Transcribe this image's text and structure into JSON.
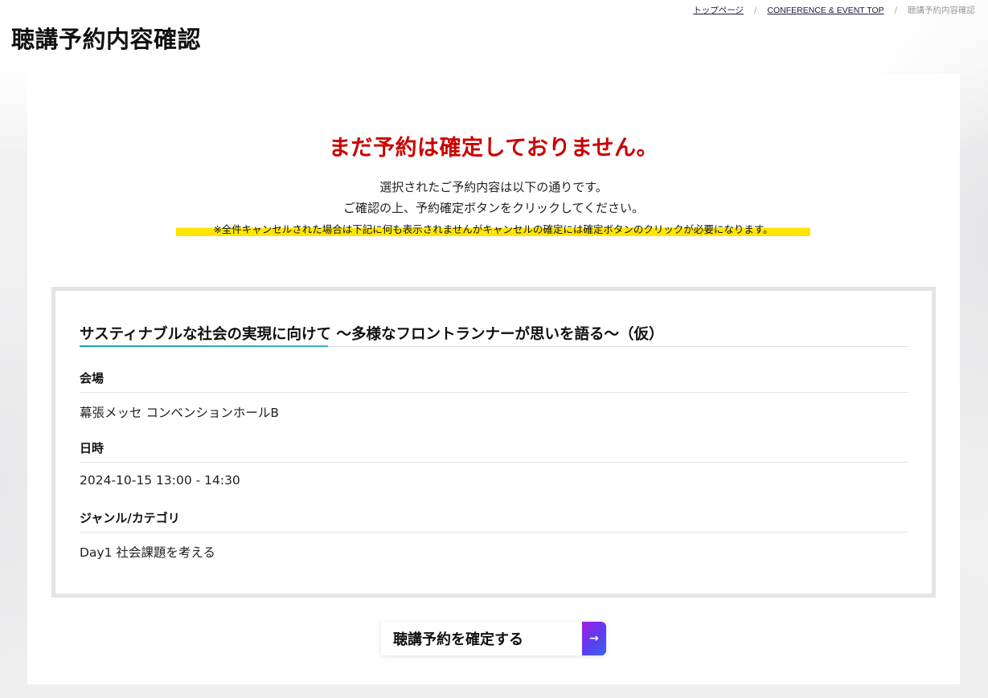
{
  "header": {
    "title": "聴講予約内容確認",
    "breadcrumb": [
      {
        "label": "トップページ",
        "link": true
      },
      {
        "label": "CONFERENCE & EVENT TOP",
        "link": true
      },
      {
        "label": "聴講予約内容確認",
        "link": false
      }
    ],
    "separator": "/"
  },
  "notice": {
    "title": "まだ予約は確定しておりません。",
    "line1": "選択されたご予約内容は以下の通りです。",
    "line2": "ご確認の上、予約確定ボタンをクリックしてください。",
    "warning": "※全件キャンセルされた場合は下記に何も表示されませんがキャンセルの確定には確定ボタンのクリックが必要になります。",
    "title_color": "#cc0000",
    "highlight_color": "#ffe600"
  },
  "reservation": {
    "event_title": "サスティナブルな社会の実現に向けて 〜多様なフロントランナーが思いを語る〜（仮）",
    "fields": [
      {
        "label": "会場",
        "value": "幕張メッセ コンベンションホールB"
      },
      {
        "label": "日時",
        "value": "2024-10-15 13:00 - 14:30"
      },
      {
        "label": "ジャンル/カテゴリ",
        "value": "Day1 社会課題を考える"
      }
    ],
    "accent_color": "#16a5a5"
  },
  "actions": {
    "confirm_label": "聴講予約を確定する",
    "confirm_icon": "arrow-right-icon",
    "arrow_glyph": "→"
  }
}
